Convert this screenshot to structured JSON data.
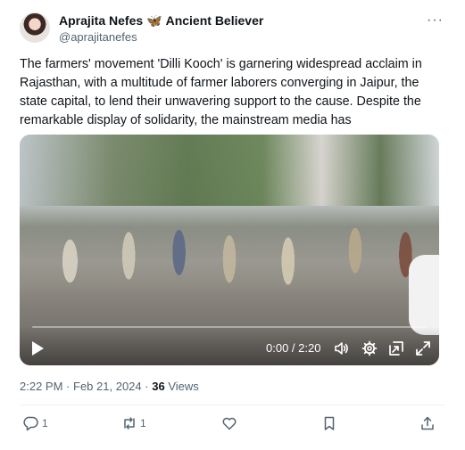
{
  "author": {
    "display_name": "Aprajita Nefes",
    "badge_icon": "butterfly-icon",
    "badge_glyph": "🦋",
    "title": "Ancient Believer",
    "handle": "@aprajitanefes"
  },
  "tweet": {
    "text": "The farmers' movement 'Dilli Kooch' is garnering widespread acclaim in Rajasthan, with a multitude of farmer laborers converging in Jaipur, the state capital, to lend their unwavering support to the cause. Despite the remarkable display of solidarity, the mainstream media has"
  },
  "video": {
    "time": "0:00 / 2:20",
    "progress": 0
  },
  "meta": {
    "time": "2:22 PM",
    "separator": "·",
    "date": "Feb 21, 2024",
    "views_count": "36",
    "views_label": "Views"
  },
  "actions": {
    "replies": "1",
    "reposts": "1"
  },
  "colors": {
    "accent": "#1d9bf0",
    "text_primary": "#0f1419",
    "text_secondary": "#536471"
  }
}
